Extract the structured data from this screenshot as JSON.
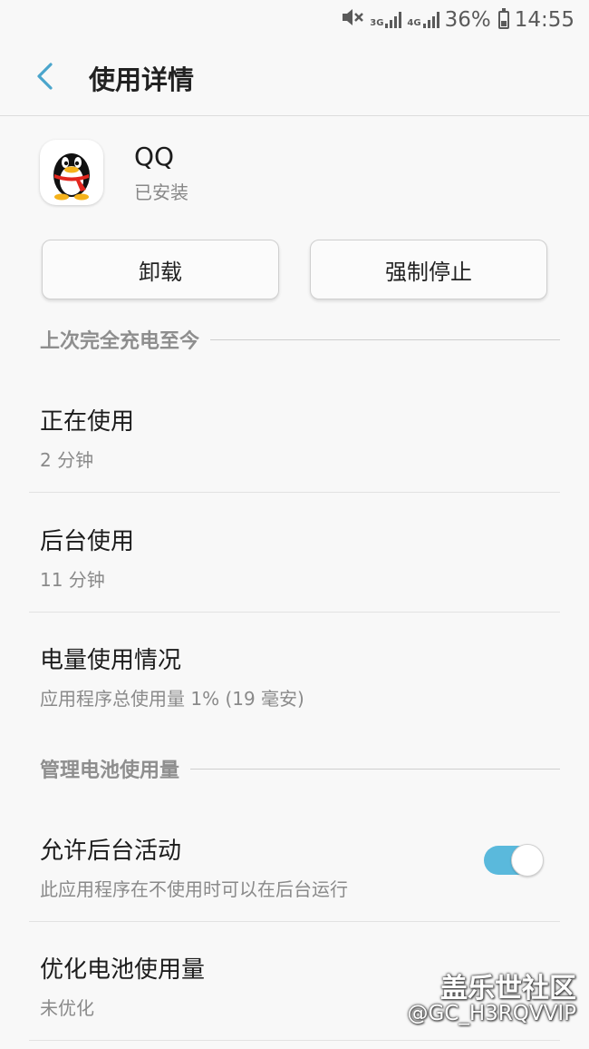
{
  "status_bar": {
    "network_1": "3G",
    "network_2": "4G",
    "battery_percent": "36%",
    "battery_level": 0.36,
    "time": "14:55",
    "icons": [
      "mute-icon",
      "signal-icon",
      "battery-icon"
    ]
  },
  "header": {
    "title": "使用详情",
    "back_icon": "chevron-left-icon"
  },
  "app": {
    "name": "QQ",
    "status": "已安装",
    "icon": "qq-penguin-icon"
  },
  "buttons": {
    "uninstall": "卸载",
    "force_stop": "强制停止"
  },
  "sections": {
    "since_full_charge": "上次完全充电至今",
    "manage_battery": "管理电池使用量"
  },
  "usage": {
    "foreground": {
      "title": "正在使用",
      "value": "2 分钟"
    },
    "background": {
      "title": "后台使用",
      "value": "11 分钟"
    },
    "battery": {
      "title": "电量使用情况",
      "value": "应用程序总使用量 1% (19 毫安)"
    }
  },
  "settings": {
    "allow_background": {
      "title": "允许后台活动",
      "subtitle": "此应用程序在不使用时可以在后台运行",
      "enabled": true
    },
    "optimize_battery": {
      "title": "优化电池使用量",
      "subtitle": "未优化"
    }
  },
  "watermark": {
    "title": "盖乐世社区",
    "user": "@GC_H3RQVVIP"
  },
  "colors": {
    "accent": "#5ab9dc",
    "background": "#f8f8f8"
  }
}
